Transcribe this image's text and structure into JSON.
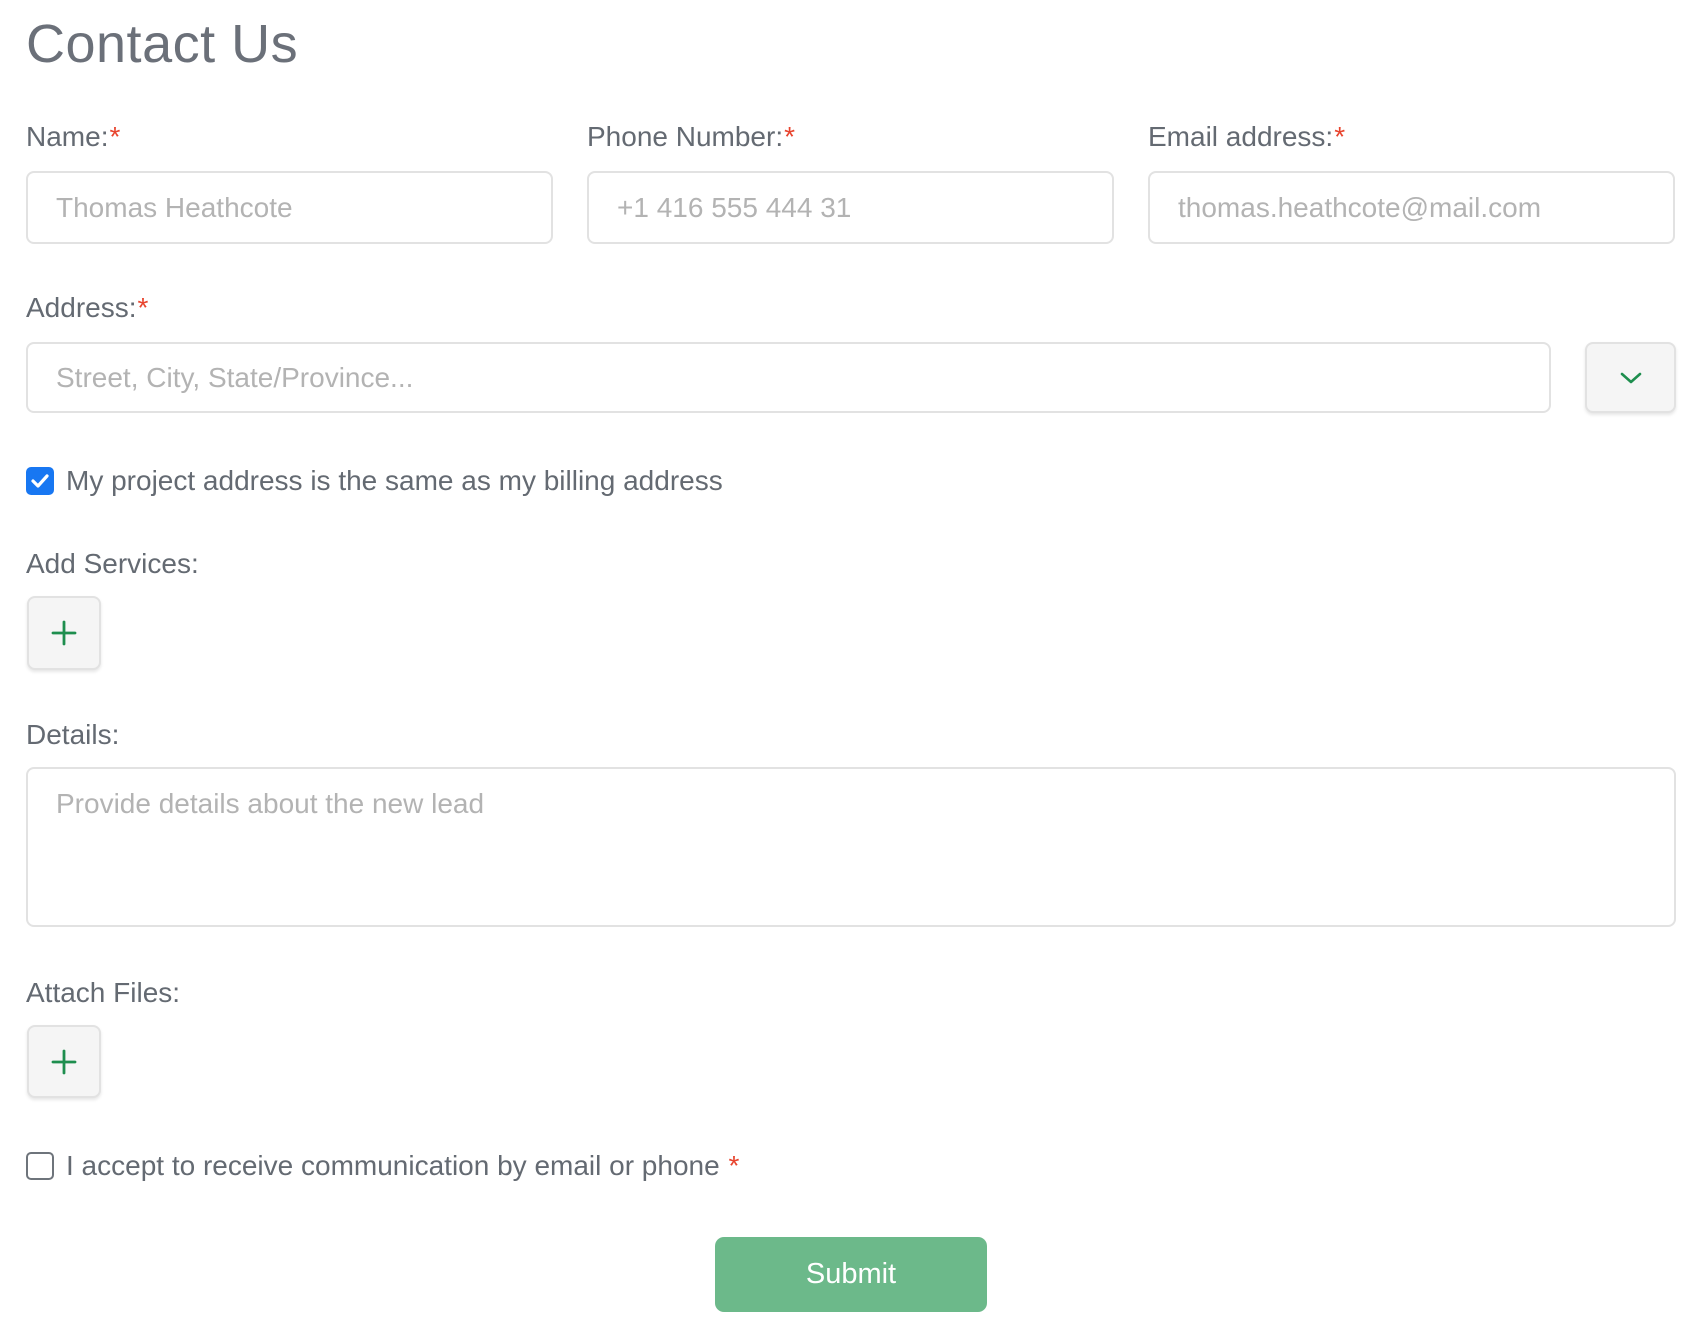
{
  "page": {
    "title": "Contact Us"
  },
  "colors": {
    "required_asterisk": "#e8442e",
    "accent_green": "#1e8e4e",
    "submit_bg": "#6cb98a",
    "checkbox_checked": "#1877f2",
    "text": "#646a72",
    "placeholder": "#b3b3b3"
  },
  "form": {
    "name": {
      "label": "Name:",
      "required_mark": "*",
      "placeholder": "Thomas Heathcote",
      "value": ""
    },
    "phone": {
      "label": "Phone Number:",
      "required_mark": "*",
      "placeholder": "+1 416 555 444 31",
      "value": ""
    },
    "email": {
      "label": "Email address:",
      "required_mark": "*",
      "placeholder": "thomas.heathcote@mail.com",
      "value": ""
    },
    "address": {
      "label": "Address:",
      "required_mark": "*",
      "placeholder": "Street, City, State/Province...",
      "value": "",
      "dropdown_icon": "chevron-down-icon"
    },
    "same_address": {
      "label": "My project address is the same as my billing address",
      "checked": true
    },
    "services": {
      "label": "Add Services:",
      "add_icon": "plus-icon"
    },
    "details": {
      "label": "Details:",
      "placeholder": "Provide details about the new lead",
      "value": ""
    },
    "attachments": {
      "label": "Attach Files:",
      "add_icon": "plus-icon"
    },
    "consent": {
      "label": "I accept to receive communication by email or phone",
      "required_mark": "*",
      "checked": false
    },
    "submit_label": "Submit"
  }
}
